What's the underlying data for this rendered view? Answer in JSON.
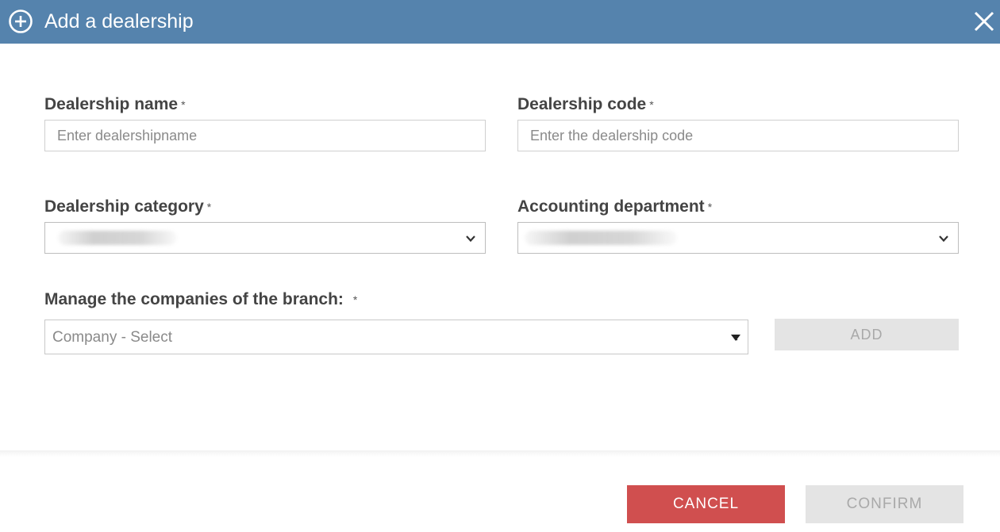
{
  "dialog": {
    "title": "Add a dealership",
    "header_color": "#5583ad",
    "icons": {
      "title_icon": "plus-circle-icon",
      "close_icon": "close-icon"
    }
  },
  "form": {
    "dealership_name": {
      "label": "Dealership name",
      "required_mark": "*",
      "value": "",
      "placeholder": "Enter dealershipname"
    },
    "dealership_code": {
      "label": "Dealership code",
      "required_mark": "*",
      "value": "",
      "placeholder": "Enter the dealership code"
    },
    "dealership_category": {
      "label": "Dealership category",
      "required_mark": "*",
      "value_state": "blurred"
    },
    "accounting_department": {
      "label": "Accounting department",
      "required_mark": "*",
      "value_state": "blurred"
    },
    "companies": {
      "label": "Manage the companies of the branch:",
      "required_mark": "*",
      "placeholder": "Company - Select",
      "add_label": "ADD"
    }
  },
  "footer": {
    "cancel_label": "CANCEL",
    "confirm_label": "CONFIRM",
    "cancel_color": "#d04f4f",
    "disabled_color": "#e4e4e4"
  }
}
